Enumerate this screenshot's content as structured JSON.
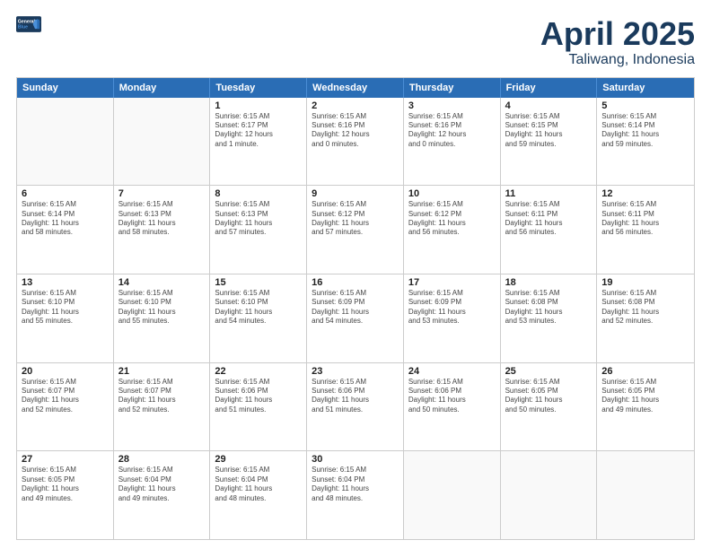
{
  "logo": {
    "line1": "General",
    "line2": "Blue"
  },
  "title": "April 2025",
  "location": "Taliwang, Indonesia",
  "header_days": [
    "Sunday",
    "Monday",
    "Tuesday",
    "Wednesday",
    "Thursday",
    "Friday",
    "Saturday"
  ],
  "weeks": [
    [
      {
        "day": "",
        "info": ""
      },
      {
        "day": "",
        "info": ""
      },
      {
        "day": "1",
        "info": "Sunrise: 6:15 AM\nSunset: 6:17 PM\nDaylight: 12 hours\nand 1 minute."
      },
      {
        "day": "2",
        "info": "Sunrise: 6:15 AM\nSunset: 6:16 PM\nDaylight: 12 hours\nand 0 minutes."
      },
      {
        "day": "3",
        "info": "Sunrise: 6:15 AM\nSunset: 6:16 PM\nDaylight: 12 hours\nand 0 minutes."
      },
      {
        "day": "4",
        "info": "Sunrise: 6:15 AM\nSunset: 6:15 PM\nDaylight: 11 hours\nand 59 minutes."
      },
      {
        "day": "5",
        "info": "Sunrise: 6:15 AM\nSunset: 6:14 PM\nDaylight: 11 hours\nand 59 minutes."
      }
    ],
    [
      {
        "day": "6",
        "info": "Sunrise: 6:15 AM\nSunset: 6:14 PM\nDaylight: 11 hours\nand 58 minutes."
      },
      {
        "day": "7",
        "info": "Sunrise: 6:15 AM\nSunset: 6:13 PM\nDaylight: 11 hours\nand 58 minutes."
      },
      {
        "day": "8",
        "info": "Sunrise: 6:15 AM\nSunset: 6:13 PM\nDaylight: 11 hours\nand 57 minutes."
      },
      {
        "day": "9",
        "info": "Sunrise: 6:15 AM\nSunset: 6:12 PM\nDaylight: 11 hours\nand 57 minutes."
      },
      {
        "day": "10",
        "info": "Sunrise: 6:15 AM\nSunset: 6:12 PM\nDaylight: 11 hours\nand 56 minutes."
      },
      {
        "day": "11",
        "info": "Sunrise: 6:15 AM\nSunset: 6:11 PM\nDaylight: 11 hours\nand 56 minutes."
      },
      {
        "day": "12",
        "info": "Sunrise: 6:15 AM\nSunset: 6:11 PM\nDaylight: 11 hours\nand 56 minutes."
      }
    ],
    [
      {
        "day": "13",
        "info": "Sunrise: 6:15 AM\nSunset: 6:10 PM\nDaylight: 11 hours\nand 55 minutes."
      },
      {
        "day": "14",
        "info": "Sunrise: 6:15 AM\nSunset: 6:10 PM\nDaylight: 11 hours\nand 55 minutes."
      },
      {
        "day": "15",
        "info": "Sunrise: 6:15 AM\nSunset: 6:10 PM\nDaylight: 11 hours\nand 54 minutes."
      },
      {
        "day": "16",
        "info": "Sunrise: 6:15 AM\nSunset: 6:09 PM\nDaylight: 11 hours\nand 54 minutes."
      },
      {
        "day": "17",
        "info": "Sunrise: 6:15 AM\nSunset: 6:09 PM\nDaylight: 11 hours\nand 53 minutes."
      },
      {
        "day": "18",
        "info": "Sunrise: 6:15 AM\nSunset: 6:08 PM\nDaylight: 11 hours\nand 53 minutes."
      },
      {
        "day": "19",
        "info": "Sunrise: 6:15 AM\nSunset: 6:08 PM\nDaylight: 11 hours\nand 52 minutes."
      }
    ],
    [
      {
        "day": "20",
        "info": "Sunrise: 6:15 AM\nSunset: 6:07 PM\nDaylight: 11 hours\nand 52 minutes."
      },
      {
        "day": "21",
        "info": "Sunrise: 6:15 AM\nSunset: 6:07 PM\nDaylight: 11 hours\nand 52 minutes."
      },
      {
        "day": "22",
        "info": "Sunrise: 6:15 AM\nSunset: 6:06 PM\nDaylight: 11 hours\nand 51 minutes."
      },
      {
        "day": "23",
        "info": "Sunrise: 6:15 AM\nSunset: 6:06 PM\nDaylight: 11 hours\nand 51 minutes."
      },
      {
        "day": "24",
        "info": "Sunrise: 6:15 AM\nSunset: 6:06 PM\nDaylight: 11 hours\nand 50 minutes."
      },
      {
        "day": "25",
        "info": "Sunrise: 6:15 AM\nSunset: 6:05 PM\nDaylight: 11 hours\nand 50 minutes."
      },
      {
        "day": "26",
        "info": "Sunrise: 6:15 AM\nSunset: 6:05 PM\nDaylight: 11 hours\nand 49 minutes."
      }
    ],
    [
      {
        "day": "27",
        "info": "Sunrise: 6:15 AM\nSunset: 6:05 PM\nDaylight: 11 hours\nand 49 minutes."
      },
      {
        "day": "28",
        "info": "Sunrise: 6:15 AM\nSunset: 6:04 PM\nDaylight: 11 hours\nand 49 minutes."
      },
      {
        "day": "29",
        "info": "Sunrise: 6:15 AM\nSunset: 6:04 PM\nDaylight: 11 hours\nand 48 minutes."
      },
      {
        "day": "30",
        "info": "Sunrise: 6:15 AM\nSunset: 6:04 PM\nDaylight: 11 hours\nand 48 minutes."
      },
      {
        "day": "",
        "info": ""
      },
      {
        "day": "",
        "info": ""
      },
      {
        "day": "",
        "info": ""
      }
    ]
  ]
}
